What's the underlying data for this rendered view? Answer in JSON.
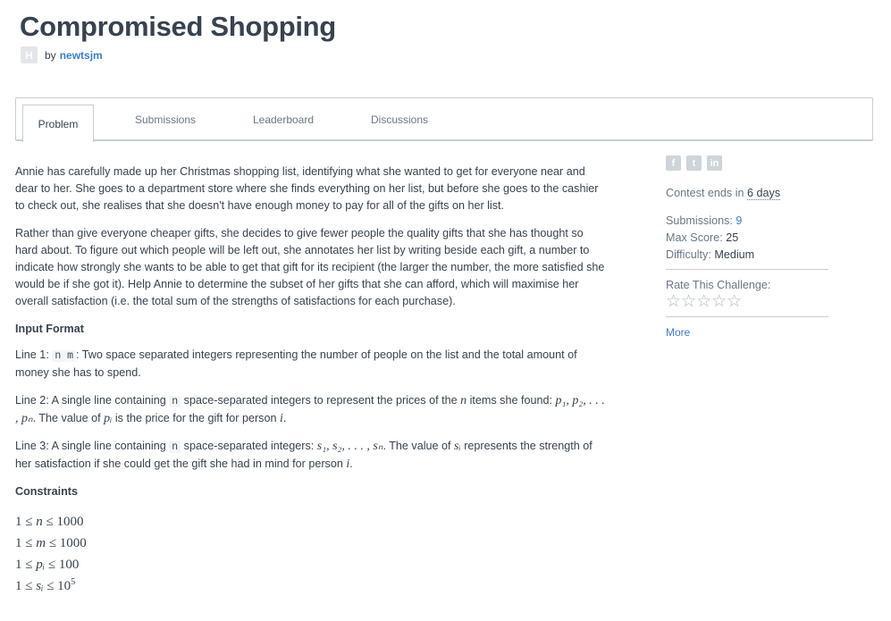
{
  "page": {
    "title": "Compromised Shopping",
    "avatar_letter": "H",
    "by": "by",
    "author": "newtsjm"
  },
  "tabs": [
    {
      "label": "Problem",
      "active": true
    },
    {
      "label": "Submissions",
      "active": false
    },
    {
      "label": "Leaderboard",
      "active": false
    },
    {
      "label": "Discussions",
      "active": false
    }
  ],
  "content": {
    "para1": "Annie has carefully made up her Christmas shopping list, identifying what she wanted to get for everyone near and dear to her. She goes to a department store where she finds everything on her list, but before she goes to the cashier to check out, she realises that she doesn't have enough money to pay for all of the gifts on her list.",
    "para2": "Rather than give everyone cheaper gifts, she decides to give fewer people the quality gifts that she has thought so hard about. To figure out which people will be left out, she annotates her list by writing beside each gift, a number to indicate how strongly she wants to be able to get that gift for its recipient (the larger the number, the more satisfied she would be if she got it). Help Annie to determine the subset of her gifts that she can afford, which will maximise her overall satisfaction (i.e. the total sum of the strengths of satisfactions for each purchase).",
    "input_heading": "Input Format",
    "line1_prefix": "Line 1: ",
    "line1_code": "n m",
    "line1_text": ": Two space separated integers representing the number of people on the list and the total amount of money she has to spend.",
    "line2_prefix": "Line 2: A single line containing ",
    "line2_code": "n",
    "line2_mid": " space-separated integers to represent the prices of the ",
    "line2_n": "n",
    "line2_mid2": " items she found: ",
    "line2_seq": "p₁, p₂, . . . , pₙ",
    "line2_mid3": ". The value of ",
    "line2_pi": "pᵢ",
    "line2_mid4": " is the price for the gift for person ",
    "line2_i": "i",
    "line2_end": ".",
    "line3_prefix": "Line 3: A single line containing ",
    "line3_code": "n",
    "line3_mid": " space-separated integers: ",
    "line3_seq": "s₁, s₂, . . . , sₙ",
    "line3_mid2": ". The value of ",
    "line3_si": "sᵢ",
    "line3_mid3": " represents the strength of her satisfaction if she could get the gift she had in mind for person ",
    "line3_i": "i",
    "line3_end": ".",
    "constraints_heading": "Constraints",
    "constraints": [
      {
        "lo": "1 ≤ ",
        "var": "n",
        "hi": " ≤ 1000",
        "sup": ""
      },
      {
        "lo": "1 ≤ ",
        "var": "m",
        "hi": " ≤ 1000",
        "sup": ""
      },
      {
        "lo": "1 ≤ ",
        "var": "pᵢ",
        "hi": " ≤ 100",
        "sup": ""
      },
      {
        "lo": "1 ≤ ",
        "var": "sᵢ",
        "hi": " ≤ 10",
        "sup": "5"
      }
    ]
  },
  "sidebar": {
    "social": [
      "f",
      "t",
      "in"
    ],
    "contest_prefix": "Contest ends in ",
    "contest_days": "6 days",
    "submissions_label": "Submissions: ",
    "submissions_value": "9",
    "max_score_label": "Max Score: ",
    "max_score_value": "25",
    "difficulty_label": "Difficulty: ",
    "difficulty_value": "Medium",
    "rate_label": "Rate This Challenge:",
    "stars": "☆☆☆☆☆",
    "more": "More"
  }
}
